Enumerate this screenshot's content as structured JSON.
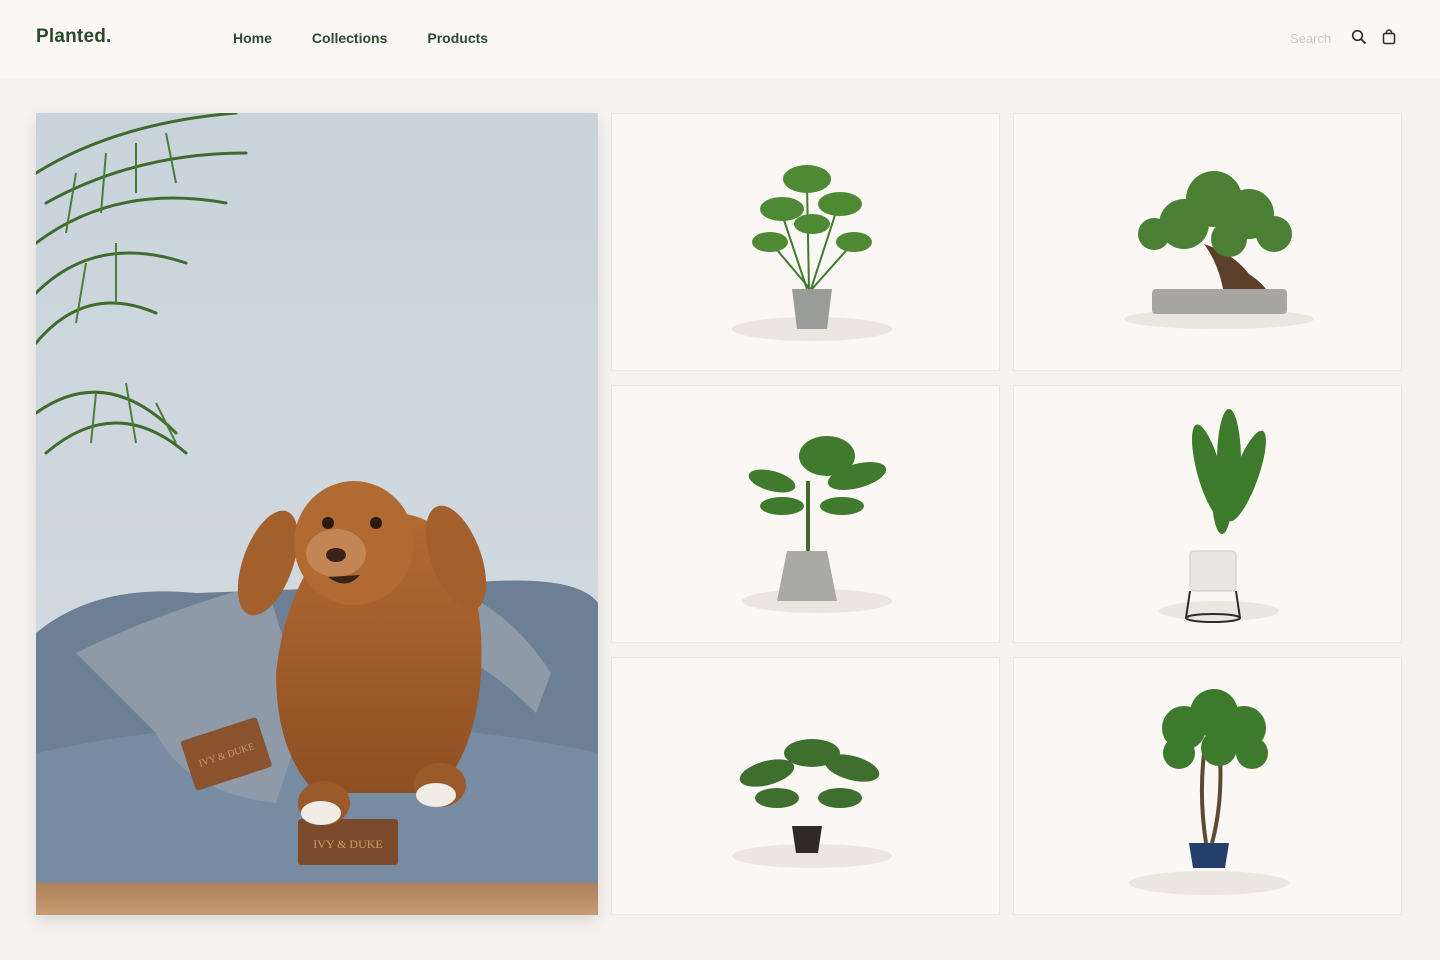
{
  "brand": {
    "name": "Planted."
  },
  "nav": {
    "items": [
      {
        "label": "Home"
      },
      {
        "label": "Collections"
      },
      {
        "label": "Products"
      }
    ]
  },
  "search": {
    "placeholder": "Search"
  },
  "icons": {
    "search": "search-icon",
    "cart": "shopping-bag-icon"
  },
  "hero": {
    "subject": "dog on bed with blanket",
    "label_bed": "IVY & DUKE",
    "label_blanket": "IVY & DUKE"
  },
  "products": [
    {
      "name": "fan palm in grey pot"
    },
    {
      "name": "bonsai in rectangular tray"
    },
    {
      "name": "banana plant in square concrete pot"
    },
    {
      "name": "bird of paradise on stand"
    },
    {
      "name": "monstera in black pot"
    },
    {
      "name": "areca palm in blue pot"
    }
  ],
  "colors": {
    "brand": "#2c4a2c",
    "background": "#f5f2ef",
    "card": "#faf7f4"
  }
}
